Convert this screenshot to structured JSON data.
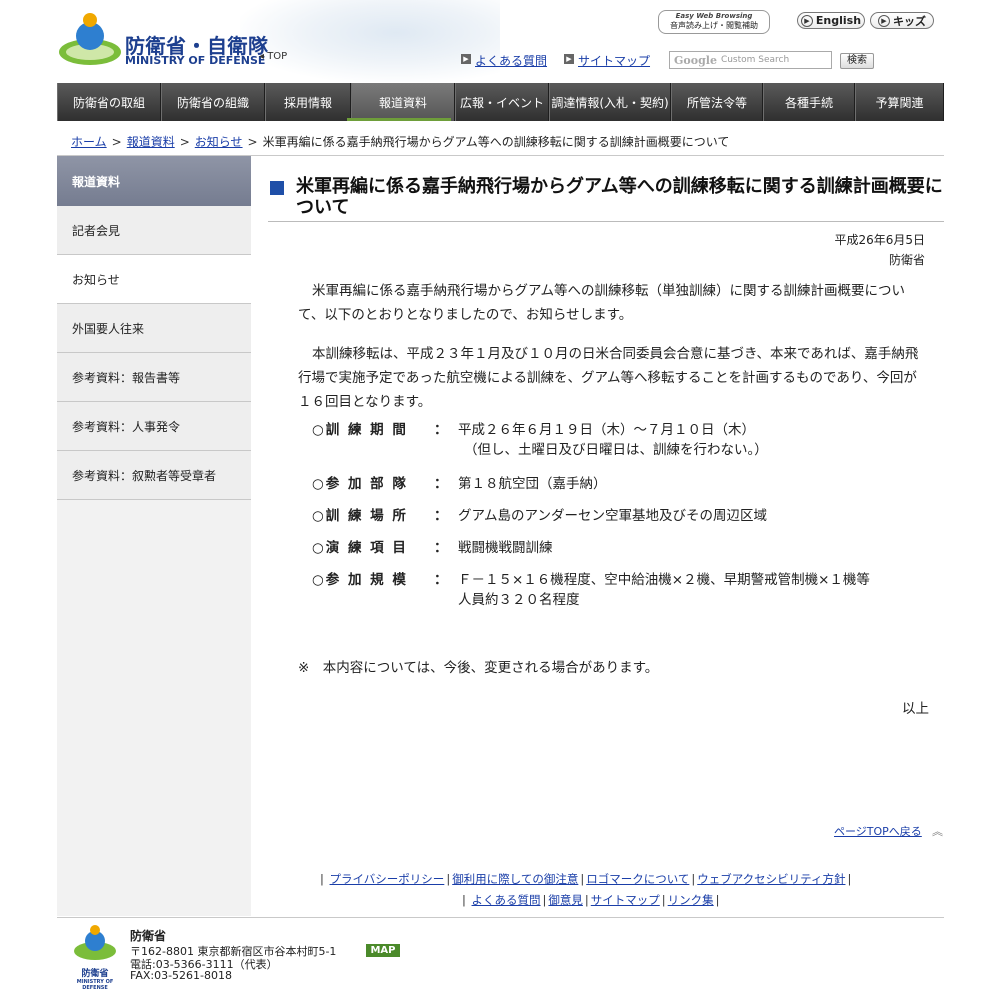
{
  "header": {
    "logo_ja": "防衛省・自衛隊",
    "logo_en": "MINISTRY OF DEFENSE",
    "top_link": "◂ TOP",
    "easy_web_title": "Easy Web Browsing",
    "easy_web_label": "音声読み上げ・閲覧補助",
    "english_label": "English",
    "kids_label": "キッズ",
    "faq_label": "よくある質問",
    "sitemap_label": "サイトマップ",
    "search_placeholder": "Custom Search",
    "search_logo": "Google",
    "search_button": "検索"
  },
  "gnav": [
    "防衛省の取組",
    "防衛省の組織",
    "採用情報",
    "報道資料",
    "広報・イベント",
    "調達情報(入札・契約)",
    "所管法令等",
    "各種手続",
    "予算関連"
  ],
  "breadcrumb": {
    "home": "ホーム",
    "press": "報道資料",
    "notice": "お知らせ",
    "current": "米軍再編に係る嘉手納飛行場からグアム等への訓練移転に関する訓練計画概要について"
  },
  "side": {
    "head": "報道資料",
    "items": [
      "記者会見",
      "お知らせ",
      "外国要人往来",
      "参考資料：報告書等",
      "参考資料：人事発令",
      "参考資料：叙勲者等受章者"
    ]
  },
  "article": {
    "title": "米軍再編に係る嘉手納飛行場からグアム等への訓練移転に関する訓練計画概要について",
    "date": "平成26年6月5日",
    "org": "防衛省",
    "para1": "米軍再編に係る嘉手納飛行場からグアム等への訓練移転（単独訓練）に関する訓練計画概要について、以下のとおりとなりましたので、お知らせします。",
    "para2": "本訓練移転は、平成２３年１月及び１０月の日米合同委員会合意に基づき、本来であれば、嘉手納飛行場で実施予定であった航空機による訓練を、グアム等へ移転することを計画するものであり、今回が１６回目となります。",
    "items": [
      {
        "label": "○訓 練 期 間",
        "value": "平成２６年６月１９日（木）～７月１０日（木）",
        "value2": "（但し、土曜日及び日曜日は、訓練を行わない。）"
      },
      {
        "label": "○参 加 部 隊",
        "value": "第１８航空団（嘉手納）"
      },
      {
        "label": "○訓 練 場 所",
        "value": "グアム島のアンダーセン空軍基地及びその周辺区域"
      },
      {
        "label": "○演 練 項 目",
        "value": "戦闘機戦闘訓練"
      },
      {
        "label": "○参 加 規 模",
        "value": "Ｆ－１５×１６機程度、空中給油機×２機、早期警戒管制機×１機等",
        "value2": "人員約３２０名程度"
      }
    ],
    "colon": "：",
    "note": "※　本内容については、今後、変更される場合があります。",
    "closing": "以上",
    "pagetop": "ページTOPへ戻る"
  },
  "footer_links_row1": [
    "プライバシーポリシー",
    "御利用に際しての御注意",
    "ロゴマークについて",
    "ウェブアクセシビリティ方針"
  ],
  "footer_links_row2": [
    "よくある質問",
    "御意見",
    "サイトマップ",
    "リンク集"
  ],
  "footer": {
    "logo_ja": "防衛省",
    "logo_en": "MINISTRY OF DEFENSE",
    "name": "防衛省",
    "address": "〒162-8801 東京都新宿区市谷本村町5-1",
    "map": "MAP",
    "tel": "電話:03-5366-3111（代表）",
    "fax": "FAX:03-5261-8018"
  },
  "colors": {
    "brand_blue": "#1d3f8f",
    "nav_dark": "#3a3a3a",
    "accent_green": "#6e9e3a",
    "title_square": "#1f4fa8"
  }
}
